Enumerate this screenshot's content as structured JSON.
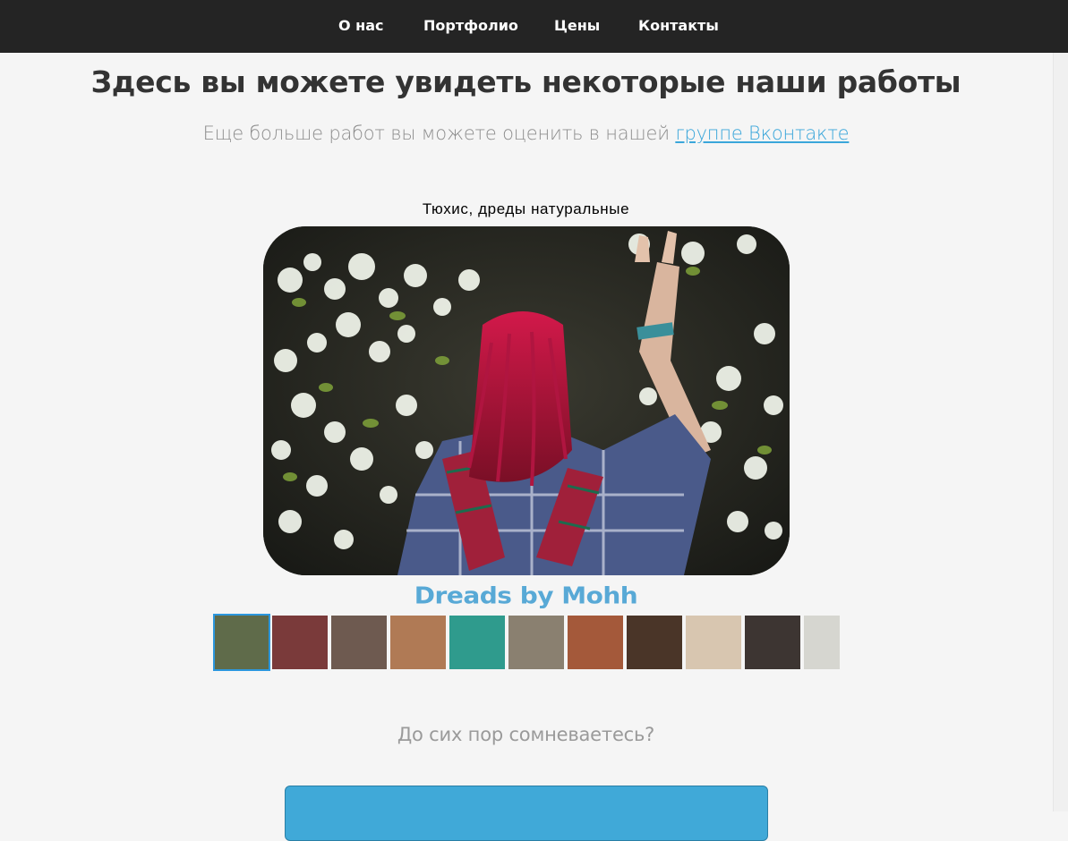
{
  "nav": {
    "items": [
      {
        "label": "О нас"
      },
      {
        "label": "Портфолио"
      },
      {
        "label": "Цены"
      },
      {
        "label": "Контакты"
      }
    ]
  },
  "heading": {
    "title": "Здесь вы можете увидеть некоторые наши работы",
    "subtitle_text": "Еще больше работ вы можете оценить в нашей ",
    "subtitle_link": "группе Вконтакте"
  },
  "gallery": {
    "caption": "Тюхис, дреды натуральные",
    "watermark": "Dreads by Mohh",
    "active_thumb": 0,
    "thumb_count": 11
  },
  "footer": {
    "question": "До сих пор сомневаетесь?"
  },
  "colors": {
    "nav_bg": "#242424",
    "accent": "#3aa6da",
    "button": "#40a9d8"
  }
}
